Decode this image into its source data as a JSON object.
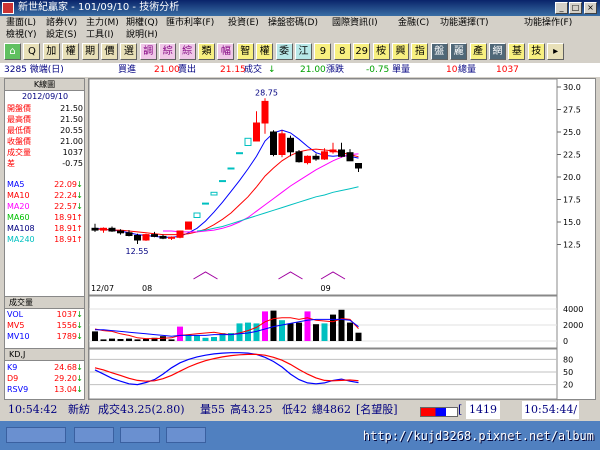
{
  "window": {
    "title": "新世紀贏家 - 101/09/10 - 技術分析"
  },
  "menu": [
    {
      "label": "畫面(L)"
    },
    {
      "label": "諮券(V)"
    },
    {
      "label": "主力(M)"
    },
    {
      "label": "期權(Q)"
    },
    {
      "label": "匯市利率(F)"
    },
    {
      "label": "投資(E)"
    },
    {
      "label": "操盤密碼(D)"
    },
    {
      "label": "國際資訊(I)"
    },
    {
      "label": "金融(C)"
    },
    {
      "label": "功能選擇(T)"
    },
    {
      "label": "功能操作(F)"
    },
    {
      "label": "檢視(Y)"
    },
    {
      "label": "設定(S)"
    },
    {
      "label": "工具(I)"
    },
    {
      "label": "說明(H)"
    }
  ],
  "toolbar": {
    "buttons": [
      {
        "label": "⌂",
        "style": "green"
      },
      {
        "label": "Q",
        "style": ""
      },
      {
        "label": "加",
        "style": ""
      },
      {
        "label": "權",
        "style": ""
      },
      {
        "label": "期",
        "style": ""
      },
      {
        "label": "價",
        "style": ""
      },
      {
        "label": "選",
        "style": ""
      },
      {
        "label": "調",
        "style": "pink"
      },
      {
        "label": "綜",
        "style": "pink"
      },
      {
        "label": "綜",
        "style": "pink"
      },
      {
        "label": "類",
        "style": "yellow"
      },
      {
        "label": "幅",
        "style": "pink"
      },
      {
        "label": "智",
        "style": "yellow"
      },
      {
        "label": "權",
        "style": "yellow"
      },
      {
        "label": "委",
        "style": "cyan"
      },
      {
        "label": "江",
        "style": "cyan"
      },
      {
        "label": "9",
        "style": "yellow"
      },
      {
        "label": "8",
        "style": "yellow"
      },
      {
        "label": "29",
        "style": "yellow"
      },
      {
        "label": "桉",
        "style": "yellow"
      },
      {
        "label": "興",
        "style": "yellow"
      },
      {
        "label": "指",
        "style": "yellow"
      },
      {
        "label": "盤",
        "style": "dark"
      },
      {
        "label": "麗",
        "style": "dark"
      },
      {
        "label": "產",
        "style": "yellow"
      },
      {
        "label": "網",
        "style": "dark"
      },
      {
        "label": "基",
        "style": "yellow"
      },
      {
        "label": "技",
        "style": "yellow"
      },
      {
        "label": "▸",
        "style": ""
      }
    ]
  },
  "infobar": {
    "stock": "3285 微端(日)",
    "buy_label": "買進",
    "buy_value": "21.00",
    "sell_label": "賣出",
    "sell_value": "21.15",
    "deal_label": "成交",
    "deal_arrow": "↓",
    "deal_value": "21.00",
    "change_label": "漲跌",
    "change_value": "-0.75",
    "volume_label": "單量",
    "volume_value": "10",
    "total_label": "總量",
    "total_value": "1037"
  },
  "panel": {
    "title": "K線圖",
    "date": "2012/09/10",
    "quote_rows": [
      {
        "label": "開盤價",
        "value": "21.50"
      },
      {
        "label": "最高價",
        "value": "21.50"
      },
      {
        "label": "最低價",
        "value": "20.55"
      },
      {
        "label": "收盤價",
        "value": "21.00"
      },
      {
        "label": "成交量",
        "value": "1037"
      },
      {
        "label": "差",
        "value": "-0.75"
      }
    ],
    "ma_rows": [
      {
        "label": "MA5",
        "value": "22.09",
        "arrow": "↓",
        "color": "#0000ff"
      },
      {
        "label": "MA10",
        "value": "22.24",
        "arrow": "↓",
        "color": "#ff0000"
      },
      {
        "label": "MA20",
        "value": "22.57",
        "arrow": "↓",
        "color": "#ff00ff"
      },
      {
        "label": "MA60",
        "value": "18.91",
        "arrow": "↑",
        "color": "#00c000"
      },
      {
        "label": "MA108",
        "value": "18.91",
        "arrow": "↑",
        "color": "#000080"
      },
      {
        "label": "MA240",
        "value": "18.91",
        "arrow": "↑",
        "color": "#00c0c0"
      }
    ],
    "vol_title": "成交量",
    "vol_rows": [
      {
        "label": "VOL",
        "value": "1037",
        "arrow": "↓",
        "color": "#0000ff"
      },
      {
        "label": "MV5",
        "value": "1556",
        "arrow": "↓",
        "color": "#ff0000"
      },
      {
        "label": "MV10",
        "value": "1789",
        "arrow": "↓",
        "color": "#0000ff"
      }
    ],
    "kd_title": "KD,J",
    "kd_rows": [
      {
        "label": "K9",
        "value": "24.68",
        "arrow": "↓",
        "color": "#0000ff"
      },
      {
        "label": "D9",
        "value": "29.20",
        "arrow": "↓",
        "color": "#ff0000"
      },
      {
        "label": "RSV9",
        "value": "13.04",
        "arrow": "↓",
        "color": "#0000ff"
      }
    ]
  },
  "chart_data": [
    {
      "type": "candlestick",
      "title": "",
      "ylim": [
        10,
        30
      ],
      "yticks": [
        "30.0",
        "27.5",
        "25.0",
        "22.5",
        "20.0",
        "17.5",
        "15.0",
        "12.5"
      ],
      "xticks": [
        "12/07",
        "08",
        "09"
      ],
      "annotations": [
        "28.75",
        "12.55"
      ],
      "candles": [
        {
          "o": 14.3,
          "h": 14.8,
          "l": 13.9,
          "c": 14.1
        },
        {
          "o": 14.1,
          "h": 14.4,
          "l": 13.8,
          "c": 14.3
        },
        {
          "o": 14.3,
          "h": 14.5,
          "l": 13.9,
          "c": 14.0
        },
        {
          "o": 14.0,
          "h": 14.2,
          "l": 13.6,
          "c": 13.8
        },
        {
          "o": 13.8,
          "h": 14.1,
          "l": 13.4,
          "c": 13.5
        },
        {
          "o": 13.5,
          "h": 13.7,
          "l": 12.55,
          "c": 13.0
        },
        {
          "o": 13.0,
          "h": 13.7,
          "l": 12.9,
          "c": 13.6
        },
        {
          "o": 13.6,
          "h": 13.9,
          "l": 13.3,
          "c": 13.4
        },
        {
          "o": 13.4,
          "h": 13.6,
          "l": 13.1,
          "c": 13.2
        },
        {
          "o": 13.2,
          "h": 13.4,
          "l": 13.0,
          "c": 13.3
        },
        {
          "o": 13.3,
          "h": 14.0,
          "l": 13.2,
          "c": 14.0
        },
        {
          "o": 14.2,
          "h": 15.0,
          "l": 14.2,
          "c": 15.0
        },
        {
          "o": 15.5,
          "h": 16.0,
          "l": 15.5,
          "c": 16.0
        },
        {
          "o": 17.0,
          "h": 17.1,
          "l": 17.0,
          "c": 17.1
        },
        {
          "o": 18.0,
          "h": 18.3,
          "l": 18.0,
          "c": 18.3
        },
        {
          "o": 19.5,
          "h": 19.6,
          "l": 19.5,
          "c": 19.6
        },
        {
          "o": 20.9,
          "h": 21.0,
          "l": 20.9,
          "c": 21.0
        },
        {
          "o": 22.6,
          "h": 22.7,
          "l": 22.6,
          "c": 22.7
        },
        {
          "o": 23.5,
          "h": 24.3,
          "l": 23.5,
          "c": 24.3
        },
        {
          "o": 24.0,
          "h": 27.3,
          "l": 24.0,
          "c": 26.0
        },
        {
          "o": 26.0,
          "h": 28.75,
          "l": 24.8,
          "c": 28.4
        },
        {
          "o": 25.0,
          "h": 25.2,
          "l": 22.3,
          "c": 22.5
        },
        {
          "o": 22.5,
          "h": 25.2,
          "l": 22.2,
          "c": 24.8
        },
        {
          "o": 24.3,
          "h": 24.6,
          "l": 22.3,
          "c": 22.8
        },
        {
          "o": 22.8,
          "h": 23.0,
          "l": 21.6,
          "c": 21.7
        },
        {
          "o": 21.6,
          "h": 22.4,
          "l": 21.4,
          "c": 22.3
        },
        {
          "o": 22.3,
          "h": 22.6,
          "l": 21.8,
          "c": 22.0
        },
        {
          "o": 22.0,
          "h": 23.2,
          "l": 21.9,
          "c": 22.8
        },
        {
          "o": 22.8,
          "h": 23.8,
          "l": 22.6,
          "c": 23.0
        },
        {
          "o": 23.0,
          "h": 23.8,
          "l": 22.2,
          "c": 22.3
        },
        {
          "o": 22.7,
          "h": 23.1,
          "l": 21.8,
          "c": 21.8
        },
        {
          "o": 21.5,
          "h": 21.5,
          "l": 20.55,
          "c": 21.0
        }
      ],
      "series": [
        {
          "name": "MA5",
          "color": "#0000ff",
          "values": [
            14.3,
            14.2,
            14.1,
            14.0,
            13.8,
            13.6,
            13.5,
            13.4,
            13.3,
            13.3,
            13.4,
            13.8,
            14.3,
            15.1,
            16.1,
            17.2,
            18.4,
            19.6,
            20.9,
            22.3,
            24.0,
            24.9,
            25.2,
            24.9,
            24.2,
            23.4,
            22.7,
            22.4,
            22.3,
            22.4,
            22.3,
            22.1
          ]
        },
        {
          "name": "MA10",
          "color": "#ff0000",
          "values": [
            14.2,
            14.2,
            14.1,
            14.1,
            14.0,
            13.9,
            13.8,
            13.7,
            13.6,
            13.6,
            13.6,
            13.7,
            13.9,
            14.2,
            14.7,
            15.3,
            16.0,
            16.9,
            17.8,
            18.9,
            20.1,
            21.0,
            21.8,
            22.4,
            22.8,
            23.0,
            23.1,
            23.0,
            22.9,
            22.7,
            22.5,
            22.24
          ]
        },
        {
          "name": "MA20",
          "color": "#ff00ff",
          "values": [
            null,
            null,
            null,
            null,
            null,
            null,
            null,
            null,
            14.0,
            14.0,
            13.9,
            13.9,
            13.9,
            14.0,
            14.1,
            14.3,
            14.6,
            15.0,
            15.5,
            16.2,
            16.9,
            17.6,
            18.3,
            19.0,
            19.6,
            20.2,
            20.8,
            21.3,
            21.8,
            22.2,
            22.5,
            22.57
          ]
        },
        {
          "name": "MA60",
          "color": "#00c0c0",
          "values": [
            null,
            null,
            null,
            null,
            null,
            null,
            null,
            null,
            null,
            null,
            null,
            null,
            14.0,
            14.1,
            14.3,
            14.5,
            14.8,
            15.1,
            15.4,
            15.7,
            16.0,
            16.3,
            16.6,
            16.9,
            17.2,
            17.5,
            17.8,
            18.0,
            18.3,
            18.5,
            18.7,
            18.91
          ]
        }
      ]
    },
    {
      "type": "bar",
      "title": "",
      "ylim": [
        0,
        5000
      ],
      "yticks": [
        "4000",
        "2000",
        "0"
      ],
      "values": [
        1200,
        200,
        300,
        250,
        300,
        200,
        250,
        400,
        600,
        200,
        1800,
        800,
        700,
        400,
        500,
        1000,
        1000,
        2200,
        2300,
        2200,
        3700,
        3800,
        2600,
        2200,
        2300,
        3700,
        2100,
        2200,
        3300,
        3900,
        2300,
        1037
      ],
      "bar_colors": [
        "#000000",
        "#000000",
        "#000000",
        "#000000",
        "#000000",
        "#000000",
        "#000000",
        "#000000",
        "#000000",
        "#000000",
        "#ff00ff",
        "#00c0c0",
        "#00c0c0",
        "#00c0c0",
        "#00c0c0",
        "#00c0c0",
        "#00c0c0",
        "#00c0c0",
        "#00c0c0",
        "#00c0c0",
        "#ff00ff",
        "#000000",
        "#00c0c0",
        "#000000",
        "#000000",
        "#ff00ff",
        "#000000",
        "#00c0c0",
        "#000000",
        "#000000",
        "#000000",
        "#000000"
      ],
      "series": [
        {
          "name": "MV5",
          "color": "#ff0000",
          "values": [
            1500,
            1300,
            1200,
            900,
            700,
            400,
            300,
            300,
            350,
            400,
            700,
            800,
            900,
            1000,
            1100,
            900,
            800,
            1000,
            1300,
            1700,
            2400,
            2800,
            2900,
            2900,
            2700,
            2900,
            2600,
            2500,
            2400,
            2800,
            2700,
            1556
          ]
        },
        {
          "name": "MV10",
          "color": "#0000ff",
          "values": [
            1400,
            1400,
            1300,
            1200,
            1100,
            1000,
            900,
            800,
            700,
            600,
            700,
            700,
            700,
            700,
            800,
            800,
            800,
            900,
            1000,
            1200,
            1500,
            1800,
            2000,
            2200,
            2400,
            2600,
            2700,
            2700,
            2700,
            2700,
            2600,
            1789
          ]
        }
      ]
    },
    {
      "type": "line",
      "title": "",
      "ylim": [
        0,
        100
      ],
      "yticks": [
        "80",
        "50",
        "20"
      ],
      "series": [
        {
          "name": "K9",
          "color": "#0000ff",
          "values": [
            55,
            45,
            35,
            28,
            22,
            20,
            25,
            32,
            45,
            60,
            72,
            80,
            86,
            90,
            93,
            95,
            96,
            96,
            95,
            92,
            85,
            75,
            62,
            45,
            32,
            24,
            22,
            24,
            30,
            33,
            28,
            24.68
          ]
        },
        {
          "name": "D9",
          "color": "#ff0000",
          "values": [
            60,
            55,
            48,
            42,
            35,
            30,
            28,
            29,
            34,
            42,
            52,
            62,
            70,
            77,
            82,
            86,
            89,
            91,
            92,
            92,
            90,
            85,
            78,
            68,
            56,
            45,
            36,
            30,
            29,
            30,
            31,
            29.2
          ]
        }
      ]
    }
  ],
  "ticker": {
    "time": "10:54:42",
    "name": "新紡",
    "deal": "成交43.25(2.80)",
    "vol": "量55",
    "high": "高43.25",
    "low": "低42",
    "total": "總4862",
    "tag": "[名望股]",
    "bracket_open": "[",
    "counter": "1419",
    "clock": "10:54:44/"
  },
  "taskbar": {
    "url": "http://kujd3268.pixnet.net/album"
  }
}
